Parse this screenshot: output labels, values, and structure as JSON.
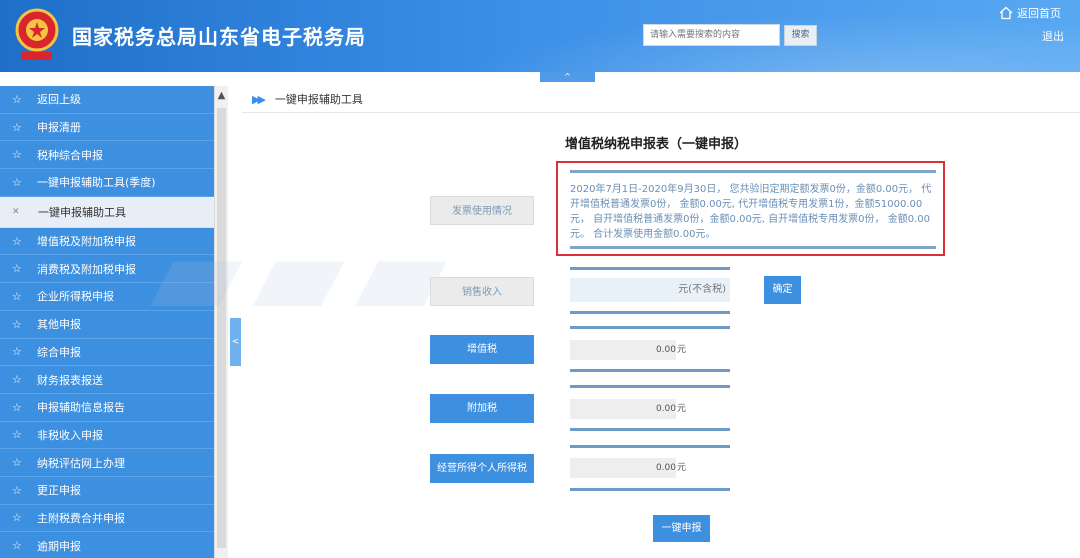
{
  "header": {
    "title": "国家税务总局山东省电子税务局",
    "search_placeholder": "请输入需要搜索的内容",
    "search_button": "搜索",
    "home_link": "返回首页",
    "logout_link": "退出",
    "collapse_glyph": "^"
  },
  "sidebar": {
    "items": [
      {
        "label": "返回上级",
        "icon": "star-icon"
      },
      {
        "label": "申报清册",
        "icon": "star-icon"
      },
      {
        "label": "税种综合申报",
        "icon": "star-icon"
      },
      {
        "label": "一键申报辅助工具(季度)",
        "icon": "star-icon"
      },
      {
        "label": "一键申报辅助工具",
        "icon": "dot-icon",
        "active": true
      },
      {
        "label": "增值税及附加税申报",
        "icon": "star-icon"
      },
      {
        "label": "消费税及附加税申报",
        "icon": "star-icon"
      },
      {
        "label": "企业所得税申报",
        "icon": "star-icon"
      },
      {
        "label": "其他申报",
        "icon": "star-icon"
      },
      {
        "label": "综合申报",
        "icon": "star-icon"
      },
      {
        "label": "财务报表报送",
        "icon": "star-icon"
      },
      {
        "label": "申报辅助信息报告",
        "icon": "star-icon"
      },
      {
        "label": "非税收入申报",
        "icon": "star-icon"
      },
      {
        "label": "纳税评估网上办理",
        "icon": "star-icon"
      },
      {
        "label": "更正申报",
        "icon": "star-icon"
      },
      {
        "label": "主附税费合并申报",
        "icon": "star-icon"
      },
      {
        "label": "逾期申报",
        "icon": "star-icon"
      }
    ],
    "toggle_glyph": "<"
  },
  "breadcrumb": {
    "current": "一键申报辅助工具"
  },
  "form": {
    "title": "增值税纳税申报表（一键申报）",
    "invoice_label": "发票使用情况",
    "invoice_info": "2020年7月1日-2020年9月30日， 您共验旧定期定额发票0份，金额0.00元， 代开增值税普通发票0份， 金额0.00元, 代开增值税专用发票1份，金额51000.00元， 自开增值税普通发票0份，金额0.00元, 自开增值税专用发票0份， 金额0.00元。 合计发票使用金额0.00元。",
    "sales_label": "销售收入",
    "sales_unit": "元(不含税)",
    "confirm_button": "确定",
    "vat_label": "增值税",
    "vat_value": "0.00",
    "vat_unit": "元",
    "surcharge_label": "附加税",
    "surcharge_value": "0.00",
    "surcharge_unit": "元",
    "iit_label": "经营所得个人所得税",
    "iit_value": "0.00",
    "iit_unit": "元",
    "submit_button": "一键申报"
  },
  "colors": {
    "header_blue": "#3a8ee6",
    "sidebar_blue": "#3d8fe0",
    "highlight_red": "#d9313a"
  }
}
